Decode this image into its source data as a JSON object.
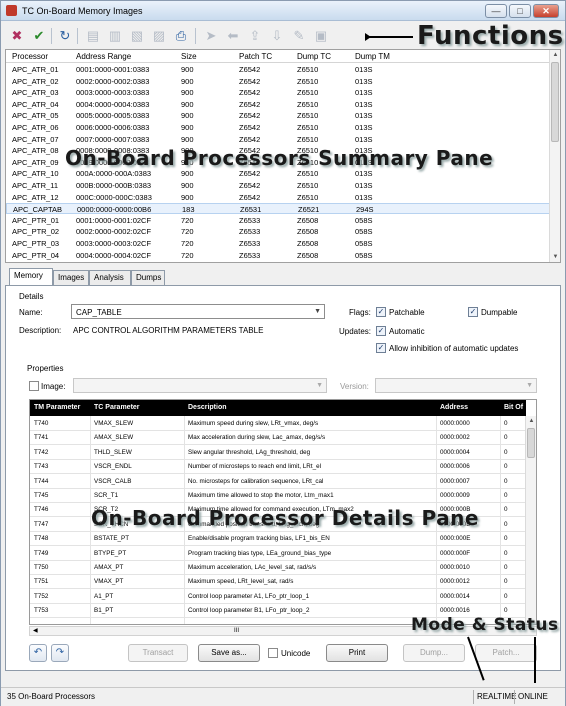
{
  "window": {
    "title": "TC On-Board Memory Images",
    "min": "—",
    "max": "□",
    "close": "✕"
  },
  "callouts": {
    "functions": "Functions",
    "summary": "On-Board Processors Summary Pane",
    "details": "On-Board Processor Details Pane",
    "mode_status": "Mode & Status"
  },
  "toolbar": {
    "icons": [
      "delete-icon",
      "checkmark-icon",
      "refresh-icon",
      "copy-icon",
      "compare-icon",
      "export-icon",
      "import-icon",
      "print-icon",
      "send-icon",
      "receive-icon",
      "upload-icon",
      "download-icon",
      "patch-icon",
      "dump-icon"
    ],
    "glyphs": [
      "✖",
      "✔",
      "↻",
      "▤",
      "▥",
      "▧",
      "▨",
      "⎙",
      "➤",
      "⬅",
      "⇪",
      "⇩",
      "✎",
      "▣"
    ]
  },
  "summary": {
    "columns": [
      "Processor",
      "Address Range",
      "Size",
      "Patch TC",
      "Dump TC",
      "Dump TM"
    ],
    "rows": [
      [
        "APC_ATR_01",
        "0001:0000-0001:0383",
        "900",
        "Z6542",
        "Z6510",
        "013S"
      ],
      [
        "APC_ATR_02",
        "0002:0000-0002:0383",
        "900",
        "Z6542",
        "Z6510",
        "013S"
      ],
      [
        "APC_ATR_03",
        "0003:0000-0003:0383",
        "900",
        "Z6542",
        "Z6510",
        "013S"
      ],
      [
        "APC_ATR_04",
        "0004:0000-0004:0383",
        "900",
        "Z6542",
        "Z6510",
        "013S"
      ],
      [
        "APC_ATR_05",
        "0005:0000-0005:0383",
        "900",
        "Z6542",
        "Z6510",
        "013S"
      ],
      [
        "APC_ATR_06",
        "0006:0000-0006:0383",
        "900",
        "Z6542",
        "Z6510",
        "013S"
      ],
      [
        "APC_ATR_07",
        "0007:0000-0007:0383",
        "900",
        "Z6542",
        "Z6510",
        "013S"
      ],
      [
        "APC_ATR_08",
        "0008:0000-0008:0383",
        "900",
        "Z6542",
        "Z6510",
        "013S"
      ],
      [
        "APC_ATR_09",
        "0009:0000-0009:0383",
        "900",
        "Z6542",
        "Z6510",
        "013S"
      ],
      [
        "APC_ATR_10",
        "000A:0000-000A:0383",
        "900",
        "Z6542",
        "Z6510",
        "013S"
      ],
      [
        "APC_ATR_11",
        "000B:0000-000B:0383",
        "900",
        "Z6542",
        "Z6510",
        "013S"
      ],
      [
        "APC_ATR_12",
        "000C:0000-000C:0383",
        "900",
        "Z6542",
        "Z6510",
        "013S"
      ],
      [
        "APC_CAPTAB",
        "0000:0000-0000:00B6",
        "183",
        "Z6531",
        "Z6521",
        "294S"
      ],
      [
        "APC_PTR_01",
        "0001:0000-0001:02CF",
        "720",
        "Z6533",
        "Z6508",
        "058S"
      ],
      [
        "APC_PTR_02",
        "0002:0000-0002:02CF",
        "720",
        "Z6533",
        "Z6508",
        "058S"
      ],
      [
        "APC_PTR_03",
        "0003:0000-0003:02CF",
        "720",
        "Z6533",
        "Z6508",
        "058S"
      ],
      [
        "APC_PTR_04",
        "0004:0000-0004:02CF",
        "720",
        "Z6533",
        "Z6508",
        "058S"
      ]
    ],
    "selected_index": 12
  },
  "tabs": [
    "Memory",
    "Images",
    "Analysis",
    "Dumps"
  ],
  "details": {
    "group_label": "Details",
    "name_label": "Name:",
    "name_value": "CAP_TABLE",
    "description_label": "Description:",
    "description_value": "APC CONTROL ALGORITHM PARAMETERS TABLE",
    "flags_label": "Flags:",
    "patchable_label": "Patchable",
    "dumpable_label": "Dumpable",
    "updates_label": "Updates:",
    "automatic_label": "Automatic",
    "allow_label": "Allow inhibition of automatic updates",
    "properties_label": "Properties",
    "image_label": "Image:",
    "version_label": "Version:"
  },
  "params": {
    "columns": [
      "TM Parameter",
      "TC Parameter",
      "Description",
      "Address",
      "Bit Of"
    ],
    "rows": [
      [
        "T740",
        "VMAX_SLEW",
        "Maximum speed during slew, LRt_vmax, deg/s",
        "0000:0000",
        "0"
      ],
      [
        "T741",
        "AMAX_SLEW",
        "Max acceleration during slew, Lac_amax, deg/s/s",
        "0000:0002",
        "0"
      ],
      [
        "T742",
        "THLD_SLEW",
        "Slew angular threshold, LAg_threshold, deg",
        "0000:0004",
        "0"
      ],
      [
        "T743",
        "VSCR_ENDL",
        "Number of microsteps to reach end limit, LRt_el",
        "0000:0006",
        "0"
      ],
      [
        "T744",
        "VSCR_CALB",
        "No. microsteps for calibration sequence, LRt_cal",
        "0000:0007",
        "0"
      ],
      [
        "T745",
        "SCR_T1",
        "Maximum time allowed to stop the motor, Ltm_max1",
        "0000:0009",
        "0"
      ],
      [
        "T746",
        "SCR_T2",
        "Maximum time allowed for command execution, LTm_max2",
        "0000:000B",
        "0"
      ],
      [
        "T747",
        "SCR_THCN",
        "Commanded position threshold, LAg_thcn, deg",
        "0000:000D",
        "0"
      ],
      [
        "T748",
        "BSTATE_PT",
        "Enable/disable program tracking bias, LF1_bis_EN",
        "0000:000E",
        "0"
      ],
      [
        "T749",
        "BTYPE_PT",
        "Program tracking bias type, LEa_ground_bias_type",
        "0000:000F",
        "0"
      ],
      [
        "T750",
        "AMAX_PT",
        "Maximum acceleration, LAc_level_sat, rad/s/s",
        "0000:0010",
        "0"
      ],
      [
        "T751",
        "VMAX_PT",
        "Maximum speed, LRt_level_sat, rad/s",
        "0000:0012",
        "0"
      ],
      [
        "T752",
        "A1_PT",
        "Control loop parameter A1, LFo_ptr_loop_1",
        "0000:0014",
        "0"
      ],
      [
        "T753",
        "B1_PT",
        "Control loop parameter B1, LFo_ptr_loop_2",
        "0000:0016",
        "0"
      ]
    ],
    "scroll_mark": "III"
  },
  "buttons": {
    "undo_icon": "↶",
    "redo_icon": "↷",
    "transact": "Transact",
    "save_as": "Save as...",
    "unicode": "Unicode",
    "print": "Print",
    "dump": "Dump...",
    "patch": "Patch..."
  },
  "status": {
    "left": "35 On-Board Processors",
    "mode": "REALTIME",
    "state": "ONLINE"
  }
}
